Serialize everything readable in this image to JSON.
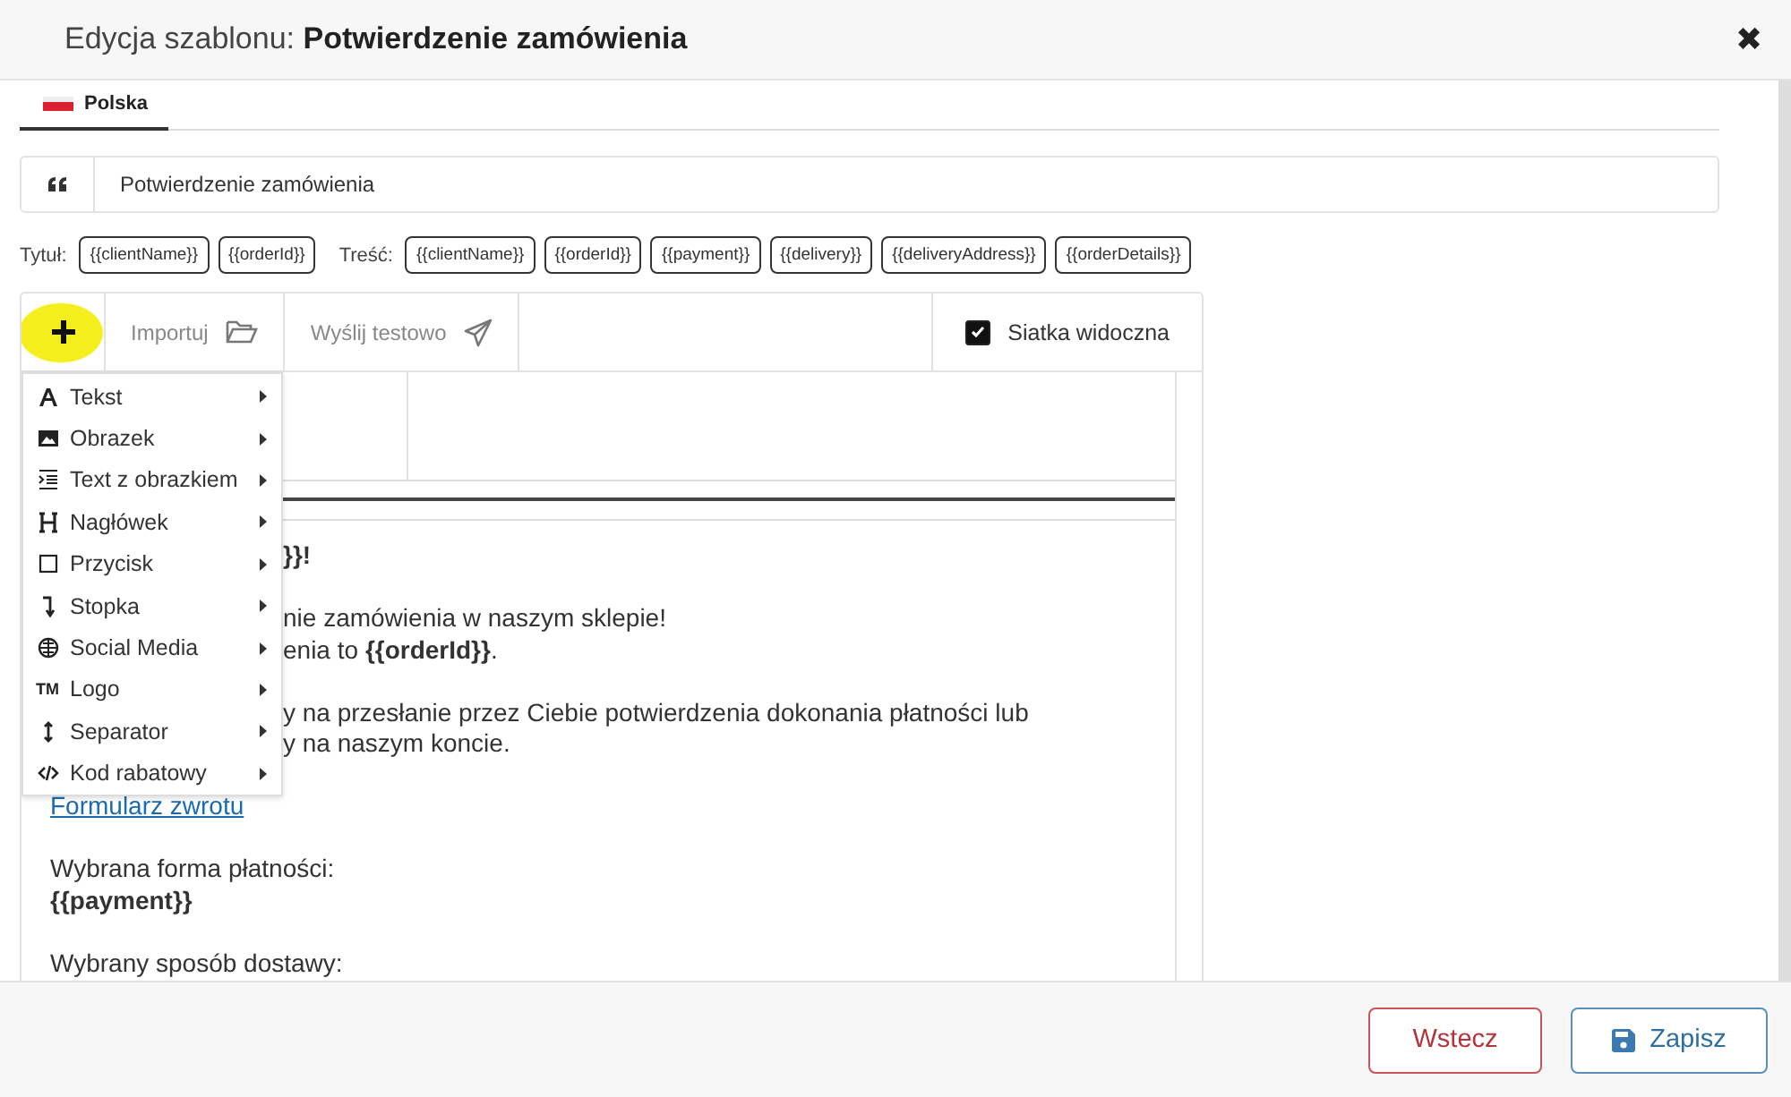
{
  "window": {
    "title": "Edycja szablonu: **Potwierdzenie zamówienia**",
    "close": "✖"
  },
  "tabs": [
    {
      "label": "Polska",
      "selected": true
    }
  ],
  "subject_field": {
    "value": "Potwierdzenie zamówienia"
  },
  "tag_groups": [
    {
      "label": "Tytuł:",
      "tags": [
        "{{clientName}}",
        "{{orderId}}"
      ]
    },
    {
      "label": "Treść:",
      "tags": [
        "{{clientName}}",
        "{{orderId}}",
        "{{payment}}",
        "{{delivery}}",
        "{{deliveryAddress}}",
        "{{orderDetails}}"
      ]
    }
  ],
  "toolbar": {
    "add_highlighted": true,
    "buttons": [
      {
        "label": "Importuj"
      },
      {
        "label": "Wyślij testowo"
      }
    ],
    "grid_checkbox": {
      "label": "Siatka widoczna",
      "checked": true
    }
  },
  "insert_menu": [
    {
      "label": "Tekst"
    },
    {
      "label": "Obrazek"
    },
    {
      "label": "Text z obrazkiem"
    },
    {
      "label": "Nagłówek"
    },
    {
      "label": "Przycisk"
    },
    {
      "label": "Stopka"
    },
    {
      "label": "Social Media"
    },
    {
      "label": "Logo",
      "icon_text": "TM"
    },
    {
      "label": "Separator"
    },
    {
      "label": "Kod rabatowy"
    }
  ],
  "email_lines": [
    {
      "kind": "partial",
      "text": "}}!",
      "bold": true
    },
    {
      "kind": "gap"
    },
    {
      "kind": "partial",
      "text": "nie zamówienia w naszym sklepie!",
      "bold": false
    },
    {
      "kind": "partial",
      "text": "enia to **{{orderId}}**.",
      "bold": false
    },
    {
      "kind": "gap"
    },
    {
      "kind": "partial",
      "text": "y na przesłanie przez Ciebie potwierdzenia dokonania płatności lub",
      "bold": false
    },
    {
      "kind": "partial",
      "text": "y na naszym koncie.",
      "bold": false
    },
    {
      "kind": "gap"
    },
    {
      "kind": "link",
      "text": "Formularz zwrotu",
      "bold": false
    },
    {
      "kind": "gap"
    },
    {
      "kind": "text",
      "text": "Wybrana forma płatności:",
      "bold": false
    },
    {
      "kind": "text",
      "text": "{{payment}}",
      "bold": true
    },
    {
      "kind": "gap"
    },
    {
      "kind": "text",
      "text": "Wybrany sposób dostawy:",
      "bold": false
    }
  ],
  "footer": {
    "buttons": [
      {
        "label": "Wstecz",
        "kind": "back"
      },
      {
        "label": "Zapisz",
        "kind": "save"
      }
    ]
  }
}
